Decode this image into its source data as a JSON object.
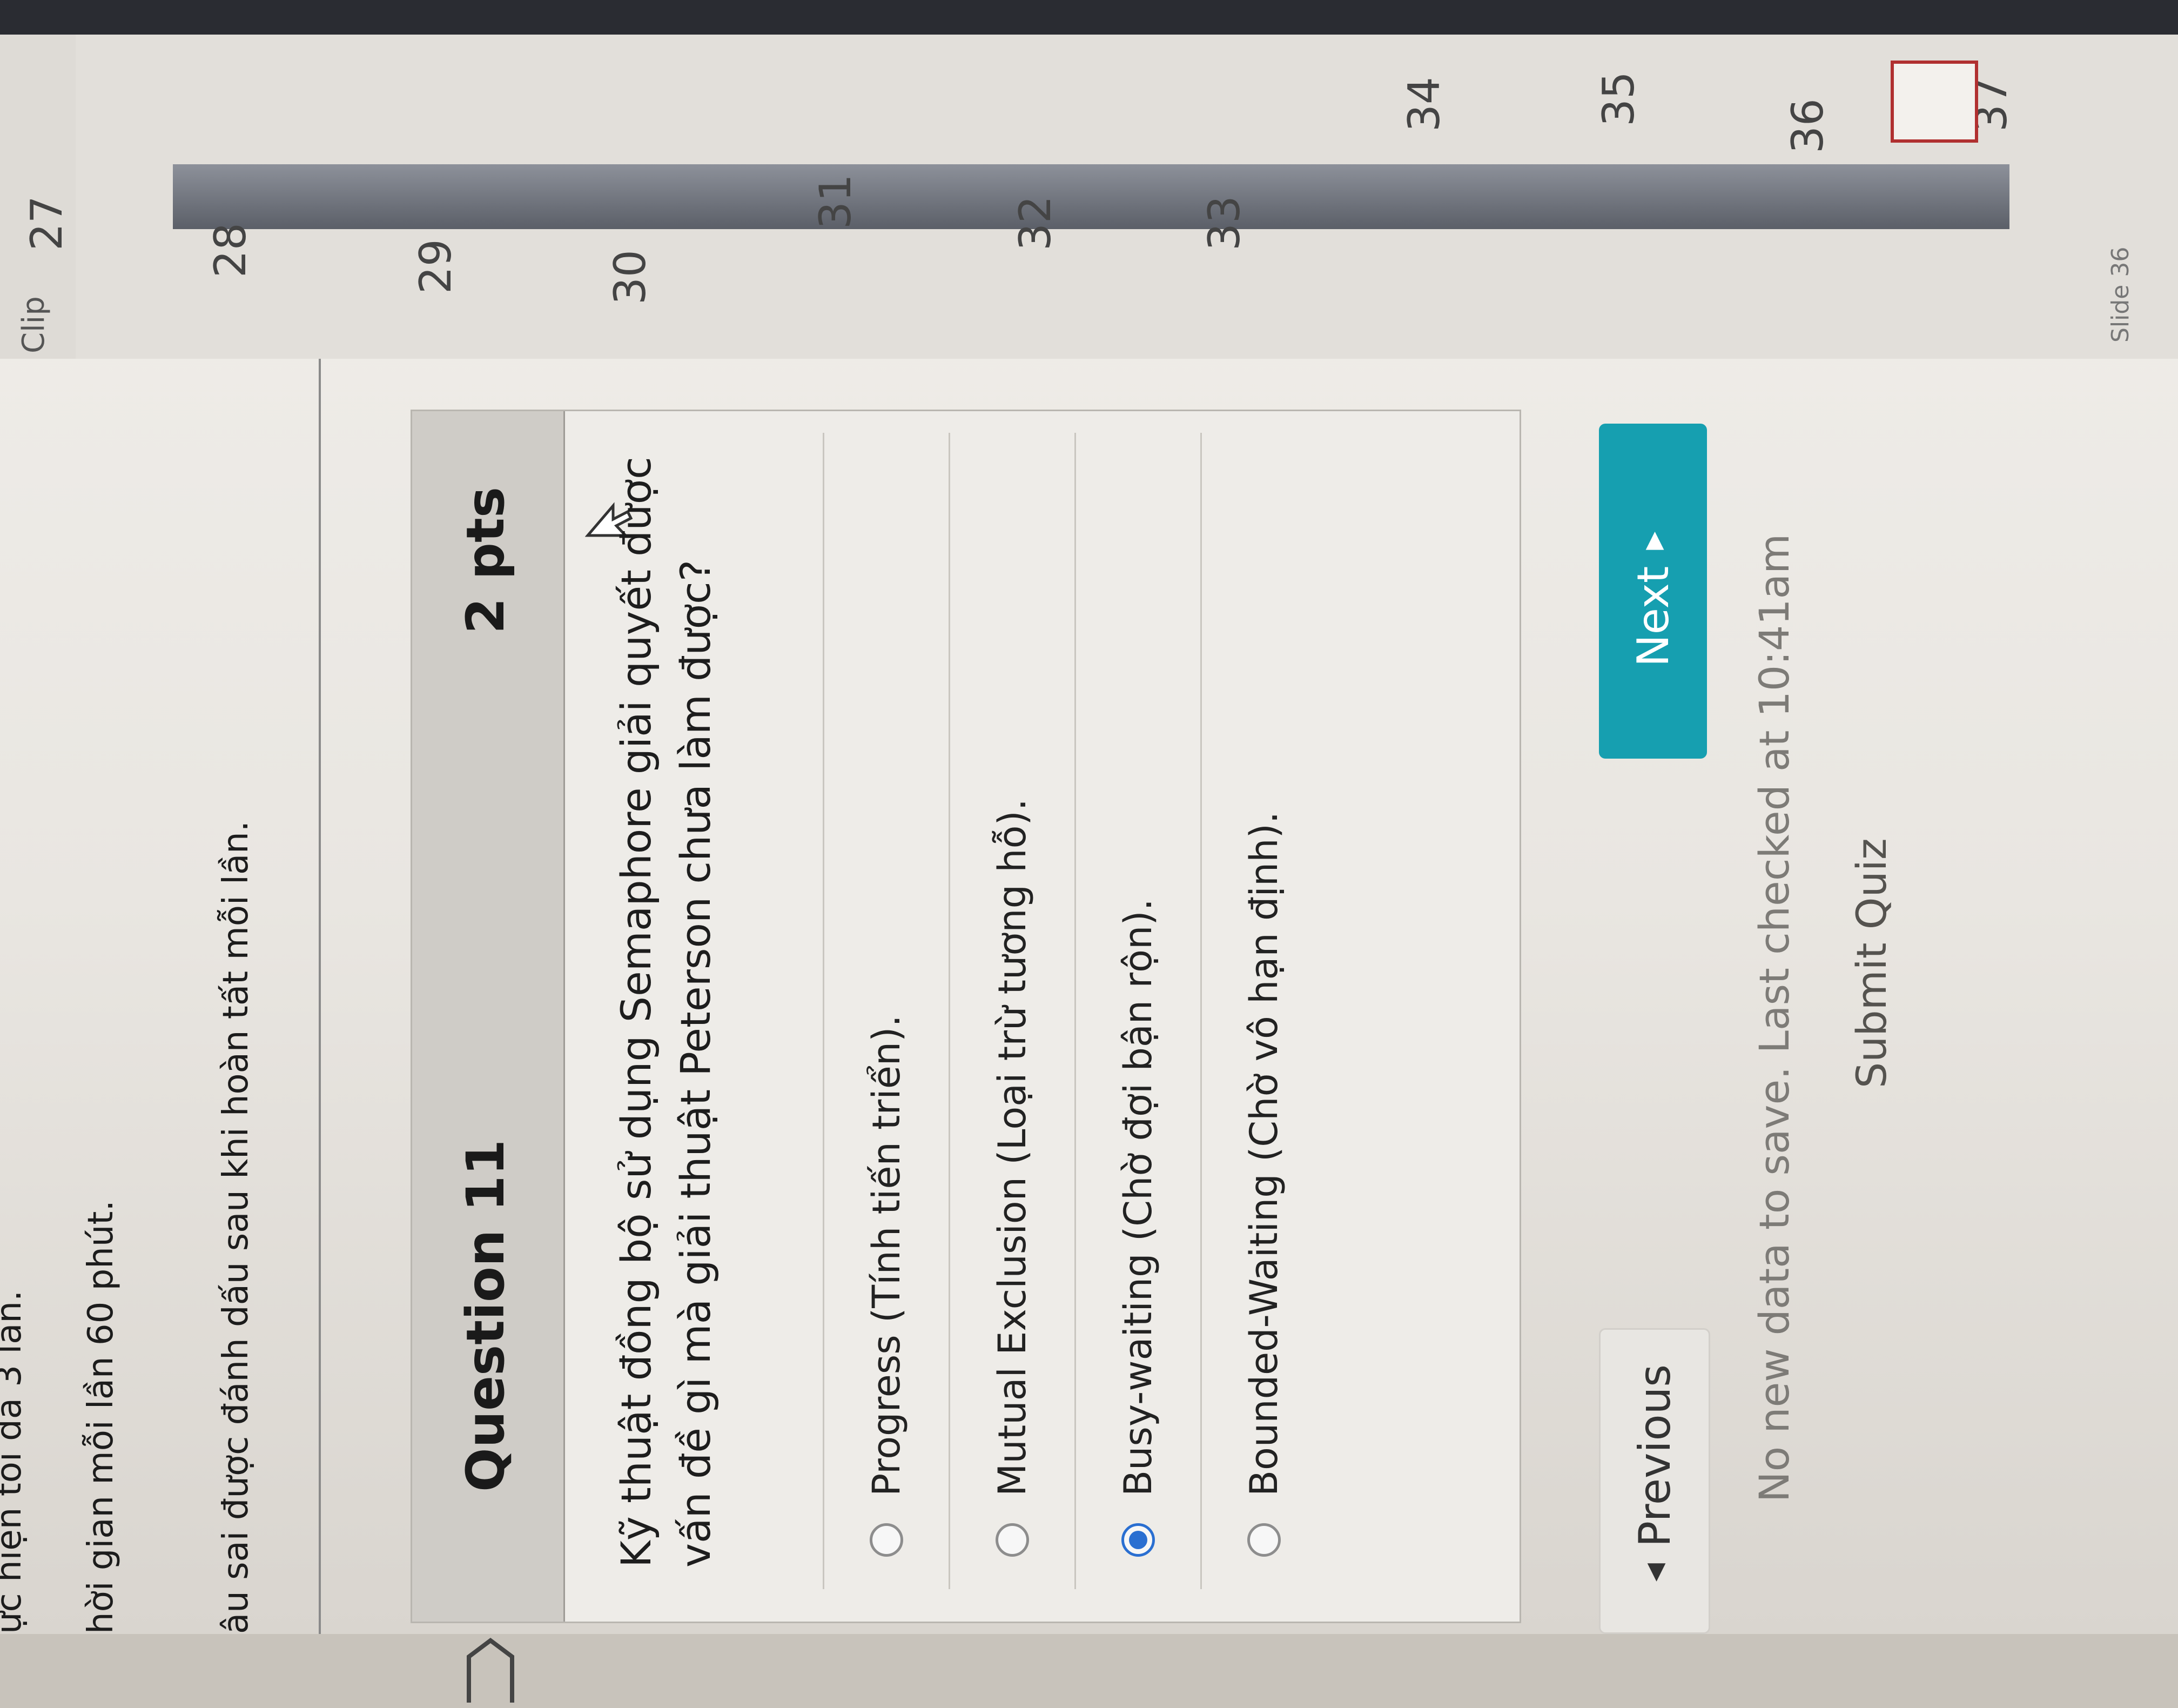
{
  "instructions": {
    "line1": "ực hiện tối đa 3 lần.",
    "line2": "hời gian mỗi lần 60 phút.",
    "line3": "âu sai được đánh dấu sau khi hoàn tất mỗi lần."
  },
  "question": {
    "title": "Question 11",
    "points": "2 pts",
    "text": "Kỹ thuật đồng bộ sử dụng Semaphore giải quyết được vấn đề gì mà giải thuật Peterson chưa làm được?",
    "answers": [
      {
        "label": "Progress (Tính tiến triển).",
        "selected": false
      },
      {
        "label": "Mutual Exclusion (Loại trừ tương hỗ).",
        "selected": false
      },
      {
        "label": "Busy-waiting (Chờ đợi bận rộn).",
        "selected": true
      },
      {
        "label": "Bounded-Waiting (Chờ vô hạn định).",
        "selected": false
      }
    ]
  },
  "nav": {
    "previous_label": "Previous",
    "next_label": "Next"
  },
  "status_text": "No new data to save. Last checked at 10:41am",
  "submit_label": "Submit Quiz",
  "side_panel": {
    "clip_label": "Clip",
    "slide_numbers": [
      "27",
      "28",
      "29",
      "30",
      "31",
      "32",
      "33",
      "34",
      "35",
      "36",
      "37"
    ],
    "slide_label": "Slide 36"
  },
  "colors": {
    "next_button": "#169fb0",
    "selected_radio": "#2a6fd1"
  }
}
